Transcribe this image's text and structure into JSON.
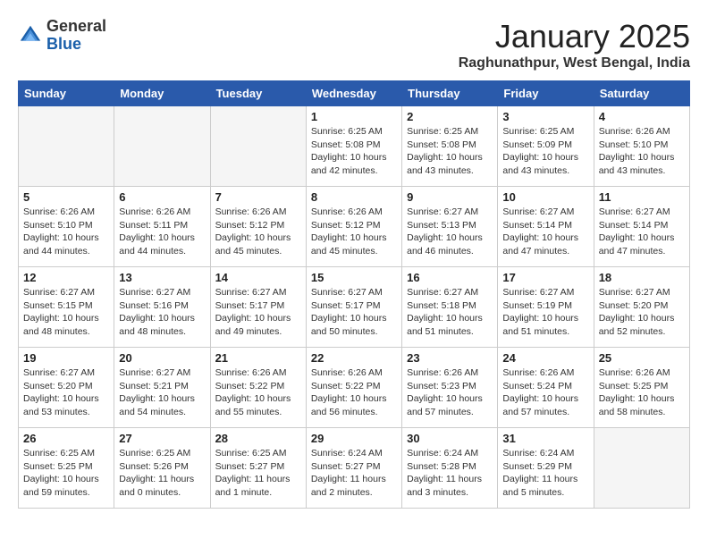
{
  "header": {
    "logo_general": "General",
    "logo_blue": "Blue",
    "month_title": "January 2025",
    "location": "Raghunathpur, West Bengal, India"
  },
  "days_of_week": [
    "Sunday",
    "Monday",
    "Tuesday",
    "Wednesday",
    "Thursday",
    "Friday",
    "Saturday"
  ],
  "weeks": [
    [
      {
        "day": "",
        "info": ""
      },
      {
        "day": "",
        "info": ""
      },
      {
        "day": "",
        "info": ""
      },
      {
        "day": "1",
        "info": "Sunrise: 6:25 AM\nSunset: 5:08 PM\nDaylight: 10 hours\nand 42 minutes."
      },
      {
        "day": "2",
        "info": "Sunrise: 6:25 AM\nSunset: 5:08 PM\nDaylight: 10 hours\nand 43 minutes."
      },
      {
        "day": "3",
        "info": "Sunrise: 6:25 AM\nSunset: 5:09 PM\nDaylight: 10 hours\nand 43 minutes."
      },
      {
        "day": "4",
        "info": "Sunrise: 6:26 AM\nSunset: 5:10 PM\nDaylight: 10 hours\nand 43 minutes."
      }
    ],
    [
      {
        "day": "5",
        "info": "Sunrise: 6:26 AM\nSunset: 5:10 PM\nDaylight: 10 hours\nand 44 minutes."
      },
      {
        "day": "6",
        "info": "Sunrise: 6:26 AM\nSunset: 5:11 PM\nDaylight: 10 hours\nand 44 minutes."
      },
      {
        "day": "7",
        "info": "Sunrise: 6:26 AM\nSunset: 5:12 PM\nDaylight: 10 hours\nand 45 minutes."
      },
      {
        "day": "8",
        "info": "Sunrise: 6:26 AM\nSunset: 5:12 PM\nDaylight: 10 hours\nand 45 minutes."
      },
      {
        "day": "9",
        "info": "Sunrise: 6:27 AM\nSunset: 5:13 PM\nDaylight: 10 hours\nand 46 minutes."
      },
      {
        "day": "10",
        "info": "Sunrise: 6:27 AM\nSunset: 5:14 PM\nDaylight: 10 hours\nand 47 minutes."
      },
      {
        "day": "11",
        "info": "Sunrise: 6:27 AM\nSunset: 5:14 PM\nDaylight: 10 hours\nand 47 minutes."
      }
    ],
    [
      {
        "day": "12",
        "info": "Sunrise: 6:27 AM\nSunset: 5:15 PM\nDaylight: 10 hours\nand 48 minutes."
      },
      {
        "day": "13",
        "info": "Sunrise: 6:27 AM\nSunset: 5:16 PM\nDaylight: 10 hours\nand 48 minutes."
      },
      {
        "day": "14",
        "info": "Sunrise: 6:27 AM\nSunset: 5:17 PM\nDaylight: 10 hours\nand 49 minutes."
      },
      {
        "day": "15",
        "info": "Sunrise: 6:27 AM\nSunset: 5:17 PM\nDaylight: 10 hours\nand 50 minutes."
      },
      {
        "day": "16",
        "info": "Sunrise: 6:27 AM\nSunset: 5:18 PM\nDaylight: 10 hours\nand 51 minutes."
      },
      {
        "day": "17",
        "info": "Sunrise: 6:27 AM\nSunset: 5:19 PM\nDaylight: 10 hours\nand 51 minutes."
      },
      {
        "day": "18",
        "info": "Sunrise: 6:27 AM\nSunset: 5:20 PM\nDaylight: 10 hours\nand 52 minutes."
      }
    ],
    [
      {
        "day": "19",
        "info": "Sunrise: 6:27 AM\nSunset: 5:20 PM\nDaylight: 10 hours\nand 53 minutes."
      },
      {
        "day": "20",
        "info": "Sunrise: 6:27 AM\nSunset: 5:21 PM\nDaylight: 10 hours\nand 54 minutes."
      },
      {
        "day": "21",
        "info": "Sunrise: 6:26 AM\nSunset: 5:22 PM\nDaylight: 10 hours\nand 55 minutes."
      },
      {
        "day": "22",
        "info": "Sunrise: 6:26 AM\nSunset: 5:22 PM\nDaylight: 10 hours\nand 56 minutes."
      },
      {
        "day": "23",
        "info": "Sunrise: 6:26 AM\nSunset: 5:23 PM\nDaylight: 10 hours\nand 57 minutes."
      },
      {
        "day": "24",
        "info": "Sunrise: 6:26 AM\nSunset: 5:24 PM\nDaylight: 10 hours\nand 57 minutes."
      },
      {
        "day": "25",
        "info": "Sunrise: 6:26 AM\nSunset: 5:25 PM\nDaylight: 10 hours\nand 58 minutes."
      }
    ],
    [
      {
        "day": "26",
        "info": "Sunrise: 6:25 AM\nSunset: 5:25 PM\nDaylight: 10 hours\nand 59 minutes."
      },
      {
        "day": "27",
        "info": "Sunrise: 6:25 AM\nSunset: 5:26 PM\nDaylight: 11 hours\nand 0 minutes."
      },
      {
        "day": "28",
        "info": "Sunrise: 6:25 AM\nSunset: 5:27 PM\nDaylight: 11 hours\nand 1 minute."
      },
      {
        "day": "29",
        "info": "Sunrise: 6:24 AM\nSunset: 5:27 PM\nDaylight: 11 hours\nand 2 minutes."
      },
      {
        "day": "30",
        "info": "Sunrise: 6:24 AM\nSunset: 5:28 PM\nDaylight: 11 hours\nand 3 minutes."
      },
      {
        "day": "31",
        "info": "Sunrise: 6:24 AM\nSunset: 5:29 PM\nDaylight: 11 hours\nand 5 minutes."
      },
      {
        "day": "",
        "info": ""
      }
    ]
  ]
}
